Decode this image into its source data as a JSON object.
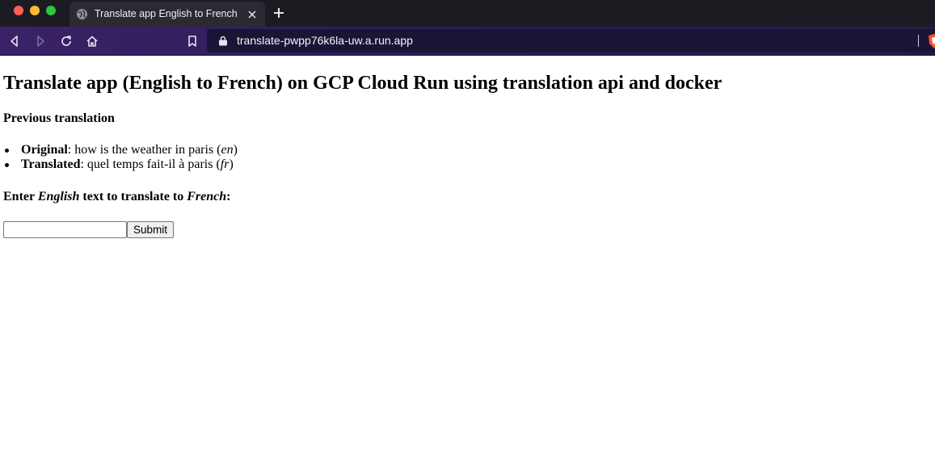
{
  "browser": {
    "tab": {
      "title": "Translate app English to French",
      "favicon": "globe-icon",
      "close_icon": "close-icon"
    },
    "new_tab_icon": "plus-icon",
    "toolbar": {
      "back_icon": "back-icon",
      "forward_icon": "forward-icon",
      "reload_icon": "reload-icon",
      "home_icon": "home-icon",
      "bookmark_icon": "bookmark-icon"
    },
    "url": "translate-pwpp76k6la-uw.a.run.app",
    "lock_icon": "lock-icon",
    "extension_icon": "brave-shield-icon",
    "colors": {
      "tabbar_bg": "#1c1b22",
      "toolbar_accent": "#3a2266",
      "urlbar_bg": "#1b1436"
    }
  },
  "page": {
    "title": "Translate app (English to French) on GCP Cloud Run using translation api and docker",
    "previous_heading": "Previous translation",
    "original": {
      "label": "Original",
      "text": ": how is the weather in paris (",
      "lang": "en",
      "close": ")"
    },
    "translated": {
      "label": "Translated",
      "text": ": quel temps fait-il à paris (",
      "lang": "fr",
      "close": ")"
    },
    "enter_prompt": {
      "part1": "Enter ",
      "lang_from": "English",
      "part2": " text to translate to ",
      "lang_to": "French",
      "part3": ":"
    },
    "input": {
      "value": "",
      "placeholder": ""
    },
    "submit_label": "Submit"
  }
}
